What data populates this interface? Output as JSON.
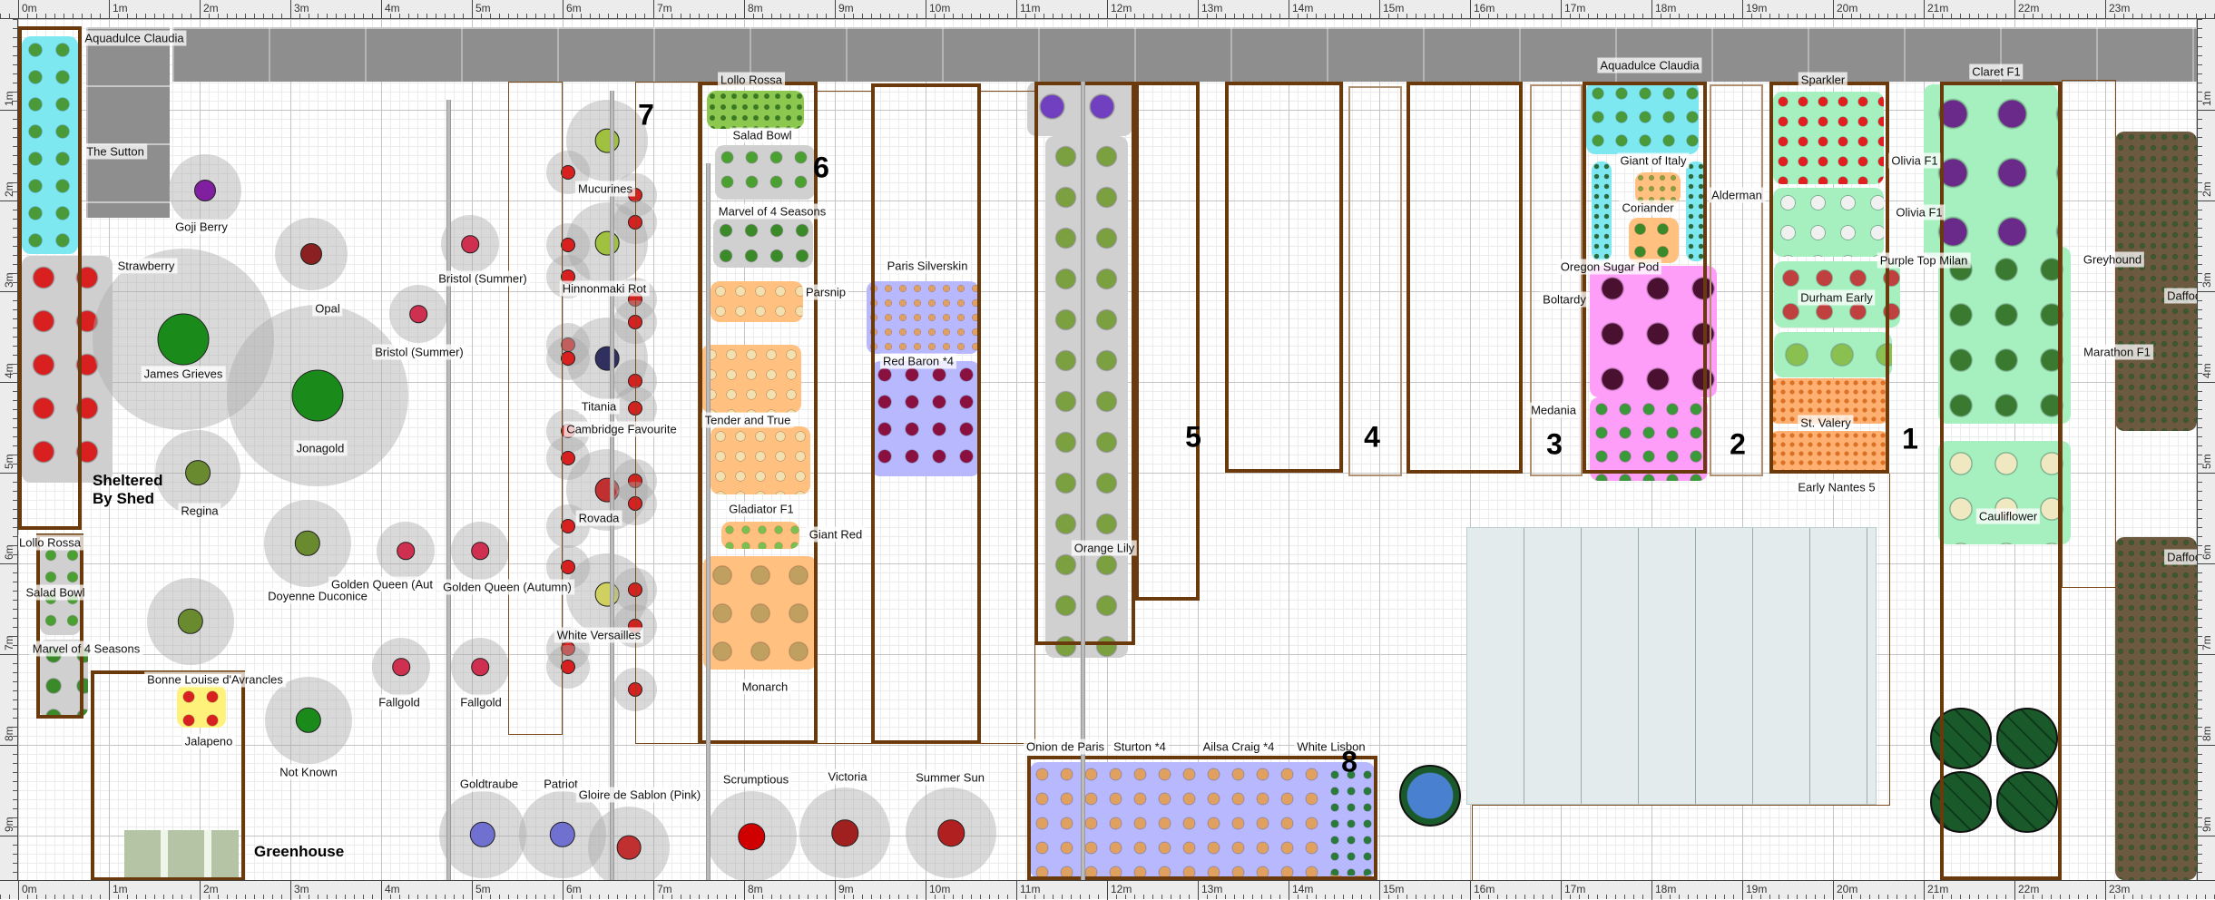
{
  "rulers": {
    "x": [
      "0m",
      "1m",
      "2m",
      "3m",
      "4m",
      "5m",
      "6m",
      "7m",
      "8m",
      "9m",
      "10m",
      "11m",
      "12m",
      "13m",
      "14m",
      "15m",
      "16m",
      "17m",
      "18m",
      "19m",
      "20m",
      "21m",
      "22m",
      "23m"
    ],
    "y": [
      "1m",
      "2m",
      "3m",
      "4m",
      "5m",
      "6m",
      "7m",
      "8m",
      "9m"
    ],
    "y_right": [
      "1m",
      "2m",
      "3m",
      "4m",
      "5m",
      "6m",
      "7m",
      "8m",
      "9m"
    ]
  },
  "areas": {
    "sheltered_line1": "Sheltered",
    "sheltered_line2": "By Shed",
    "greenhouse": "Greenhouse"
  },
  "bed_numbers": [
    "1",
    "2",
    "3",
    "4",
    "5",
    "6",
    "7",
    "8"
  ],
  "colors": {
    "frame": "#6b3a0c",
    "fence": "#8e8e8e",
    "bean_block": "#7ee8f0",
    "onion_block": "#b8b8ff",
    "root_block": "#ffc080",
    "brassica_block": "#a6f0c0",
    "beet_block": "#ff9ef8"
  },
  "labels": [
    {
      "text": "Aquadulce Claudia",
      "icon": "broad-bean"
    },
    {
      "text": "The Sutton",
      "icon": "broad-bean"
    },
    {
      "text": "Goji Berry",
      "icon": "goji-berry"
    },
    {
      "text": "Strawberry",
      "icon": "strawberry"
    },
    {
      "text": "James Grieves",
      "icon": "apple-tree"
    },
    {
      "text": "Opal",
      "icon": "plum-tree"
    },
    {
      "text": "Jonagold",
      "icon": "apple-tree"
    },
    {
      "text": "Bristol (Summer)",
      "icon": "raspberry"
    },
    {
      "text": "Bristol (Summer)",
      "icon": "raspberry"
    },
    {
      "text": "Mucurines",
      "icon": "gooseberry"
    },
    {
      "text": "Hinnonmaki Rot",
      "icon": "gooseberry"
    },
    {
      "text": "Titania",
      "icon": "blackcurrant"
    },
    {
      "text": "Cambridge Favourite",
      "icon": "strawberry"
    },
    {
      "text": "Regina",
      "icon": "cherry-tree"
    },
    {
      "text": "Rovada",
      "icon": "redcurrant"
    },
    {
      "text": "Lollo Rossa",
      "icon": "lettuce"
    },
    {
      "text": "Salad Bowl",
      "icon": "lettuce"
    },
    {
      "text": "Marvel of 4 Seasons",
      "icon": "lettuce"
    },
    {
      "text": "Doyenne Duconice",
      "icon": "pear-tree"
    },
    {
      "text": "Golden Queen (Aut",
      "icon": "raspberry"
    },
    {
      "text": "Golden Queen (Autumn)",
      "icon": "raspberry"
    },
    {
      "text": "White Versailles",
      "icon": "whitecurrant"
    },
    {
      "text": "Bonne Louise d'Avrancles",
      "icon": "pear-tree"
    },
    {
      "text": "Jalapeno",
      "icon": "chilli-pepper"
    },
    {
      "text": "Not Known",
      "icon": "cherry-tree"
    },
    {
      "text": "Fallgold",
      "icon": "raspberry"
    },
    {
      "text": "Fallgold",
      "icon": "raspberry"
    },
    {
      "text": "Goldtraube",
      "icon": "blueberry"
    },
    {
      "text": "Patriot",
      "icon": "blueberry"
    },
    {
      "text": "Gloire de Sablon (Pink)",
      "icon": "currant"
    },
    {
      "text": "Lollo Rossa",
      "icon": "lettuce"
    },
    {
      "text": "Salad Bowl",
      "icon": "lettuce"
    },
    {
      "text": "Marvel of 4 Seasons",
      "icon": "lettuce"
    },
    {
      "text": "Parsnip",
      "icon": "parsnip"
    },
    {
      "text": "Tender and True",
      "icon": "parsnip"
    },
    {
      "text": "Gladiator F1",
      "icon": "parsnip"
    },
    {
      "text": "Giant Red",
      "icon": "celery"
    },
    {
      "text": "Monarch",
      "icon": "celeriac"
    },
    {
      "text": "Paris Silverskin",
      "icon": "onion"
    },
    {
      "text": "Red Baron *4",
      "icon": "red-onion"
    },
    {
      "text": "Orange Lily",
      "icon": "lily"
    },
    {
      "text": "Onion de Paris",
      "icon": "onion"
    },
    {
      "text": "Sturton *4",
      "icon": "onion"
    },
    {
      "text": "Ailsa Craig *4",
      "icon": "onion"
    },
    {
      "text": "White Lisbon",
      "icon": "spring-onion"
    },
    {
      "text": "Scrumptious",
      "icon": "apple-tree"
    },
    {
      "text": "Victoria",
      "icon": "plum-tree"
    },
    {
      "text": "Summer Sun",
      "icon": "cherry-tree"
    },
    {
      "text": "Aquadulce Claudia",
      "icon": "broad-bean"
    },
    {
      "text": "Giant of Italy",
      "icon": "parsley"
    },
    {
      "text": "Coriander",
      "icon": "coriander"
    },
    {
      "text": "Oregon Sugar Pod",
      "icon": "pea"
    },
    {
      "text": "Boltardy",
      "icon": "beetroot"
    },
    {
      "text": "Medania",
      "icon": "spinach"
    },
    {
      "text": "Alderman",
      "icon": "pea"
    },
    {
      "text": "Sparkler",
      "icon": "radish"
    },
    {
      "text": "Purple Top Milan",
      "icon": "turnip"
    },
    {
      "text": "Durham Early",
      "icon": "cabbage"
    },
    {
      "text": "St. Valery",
      "icon": "carrot"
    },
    {
      "text": "Early Nantes 5",
      "icon": "carrot"
    },
    {
      "text": "Claret F1",
      "icon": "purple-sprouting-broccoli"
    },
    {
      "text": "Olivia F1",
      "icon": "brussels-sprout"
    },
    {
      "text": "Olivia F1",
      "icon": "brussels-sprout"
    },
    {
      "text": "Greyhound",
      "icon": "cabbage"
    },
    {
      "text": "Marathon F1",
      "icon": "broccoli"
    },
    {
      "text": "Cauliflower",
      "icon": "cauliflower"
    },
    {
      "text": "Daffodil",
      "icon": "daffodil"
    },
    {
      "text": "Daffodil",
      "icon": "daffodil"
    }
  ]
}
